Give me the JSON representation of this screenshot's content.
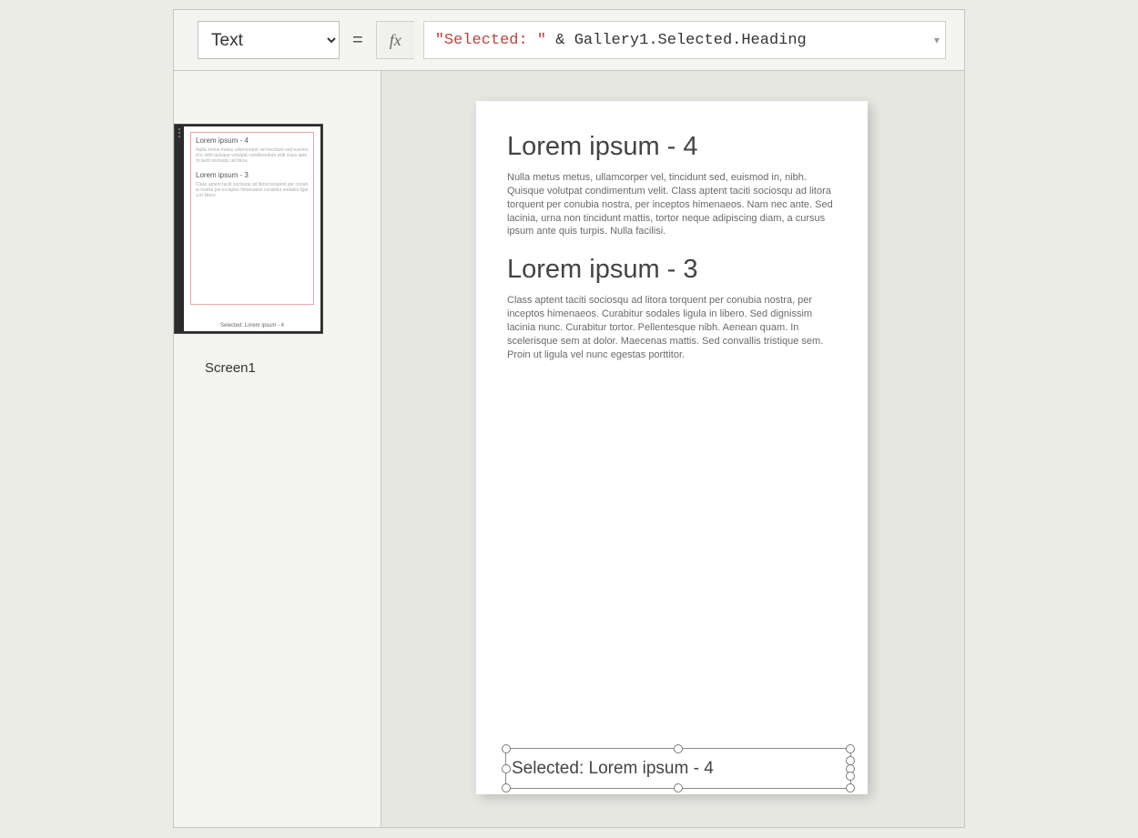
{
  "formula_bar": {
    "property_label": "Text",
    "fx_label": "fx",
    "equals": "=",
    "formula_string": "\"Selected: \"",
    "formula_operator": " & ",
    "formula_reference": "Gallery1.Selected.Heading",
    "expand_glyph": "▾"
  },
  "tree": {
    "screen_label": "Screen1",
    "thumb": {
      "item1_heading": "Lorem ipsum - 4",
      "item1_body_stub": "Nulla metus metus ullamcorper vel tincidunt sed euismod in nibh quisque volutpat condimentum velit class aptent taciti sociosqu ad litora.",
      "item2_heading": "Lorem ipsum - 3",
      "item2_body_stub": "Class aptent taciti sociosqu ad litora torquent per conubia nostra per inceptos himenaeos curabitur sodales ligula in libero.",
      "selected_label_stub": "Selected: Lorem ipsum - 4"
    }
  },
  "canvas": {
    "items": [
      {
        "heading": "Lorem ipsum - 4",
        "body": "Nulla metus metus, ullamcorper vel, tincidunt sed, euismod in, nibh. Quisque volutpat condimentum velit. Class aptent taciti sociosqu ad litora torquent per conubia nostra, per inceptos himenaeos. Nam nec ante. Sed lacinia, urna non tincidunt mattis, tortor neque adipiscing diam, a cursus ipsum ante quis turpis. Nulla facilisi."
      },
      {
        "heading": "Lorem ipsum - 3",
        "body": "Class aptent taciti sociosqu ad litora torquent per conubia nostra, per inceptos himenaeos. Curabitur sodales ligula in libero. Sed dignissim lacinia nunc. Curabitur tortor. Pellentesque nibh. Aenean quam. In scelerisque sem at dolor. Maecenas mattis. Sed convallis tristique sem. Proin ut ligula vel nunc egestas porttitor."
      }
    ],
    "selected_label_text": "Selected: Lorem ipsum - 4"
  }
}
